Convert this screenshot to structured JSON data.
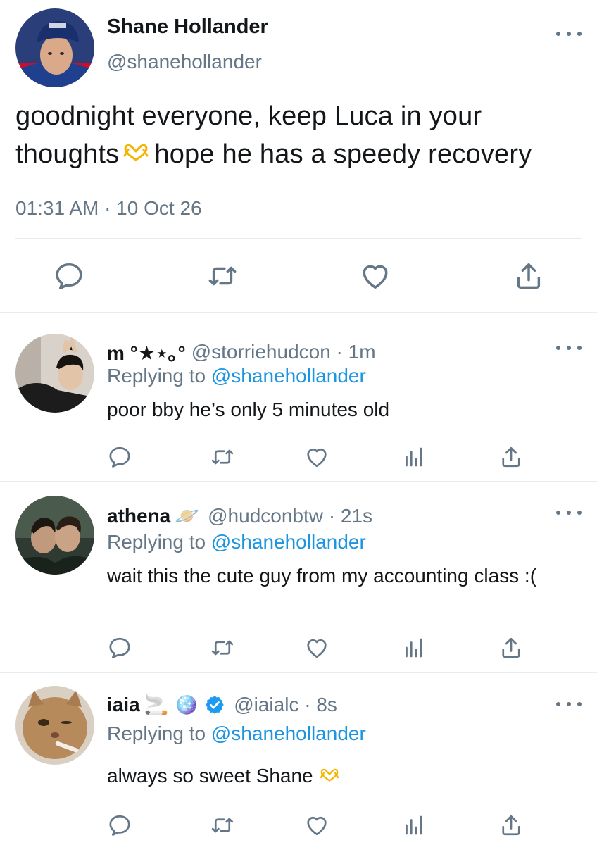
{
  "main_tweet": {
    "name": "Shane Hollander",
    "handle": "@shanehollander",
    "text_part1": "goodnight everyone, keep Luca in your thoughts",
    "text_part2": "hope he has a speedy recovery",
    "timestamp": "01:31 AM · 10 Oct 26",
    "icons": [
      "reply-icon",
      "retweet-icon",
      "like-icon",
      "share-icon"
    ]
  },
  "replies": [
    {
      "name": "m °★⋆｡°",
      "handle": "@storriehudcon · 1m",
      "replying_prefix": "Replying to",
      "replying_to": "@shanehollander",
      "text": "poor bby he’s only 5 minutes old"
    },
    {
      "name": "athena",
      "name_emoji": "🪐",
      "handle": "@hudconbtw · 21s",
      "replying_prefix": "Replying to",
      "replying_to": "@shanehollander",
      "text": "wait this the cute guy from my accounting class :("
    },
    {
      "name": "iaia",
      "name_emoji": "🚬 🪩",
      "handle": "@iaialc · 8s",
      "replying_prefix": "Replying to",
      "replying_to": "@shanehollander",
      "text": "always so sweet Shane"
    }
  ],
  "reply_actions": [
    "reply-icon",
    "retweet-icon",
    "like-icon",
    "analytics-icon",
    "share-icon"
  ],
  "colors": {
    "text": "#14171a",
    "secondary": "#657786",
    "link": "#1b95e0",
    "divider": "#e6ecf0",
    "verified": "#1d9bf0",
    "heart_hands": "#f4b400"
  }
}
